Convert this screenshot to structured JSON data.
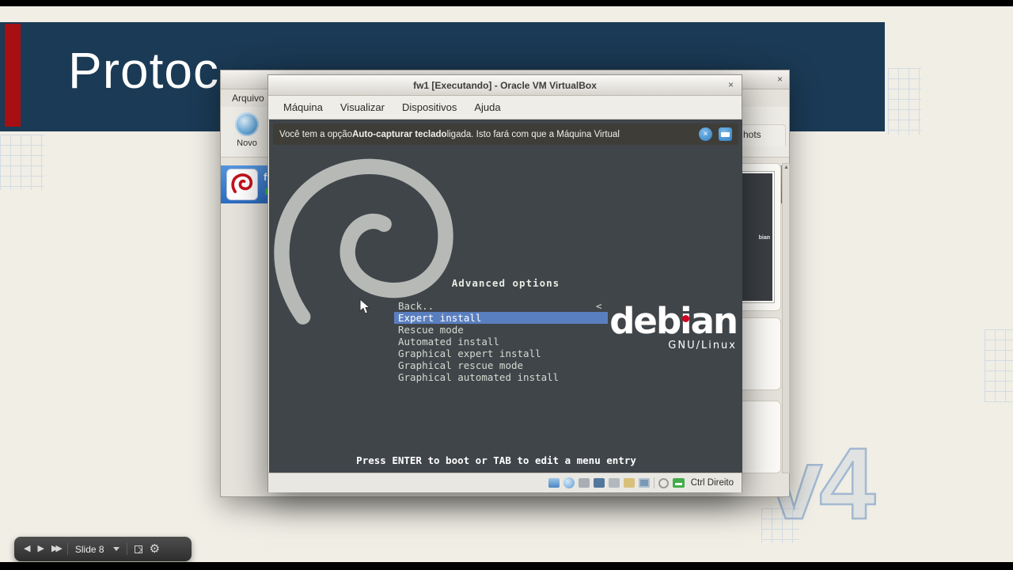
{
  "slide": {
    "title": "Protoc",
    "watermark": "v4"
  },
  "presenter_bar": {
    "slide_label": "Slide 8",
    "prev_glyph": "◀",
    "play_glyph": "▶",
    "next_glyph": "▶▶",
    "gear_glyph": "⚙"
  },
  "manager_window": {
    "menu_file": "Arquivo",
    "toolbar_new": "Novo",
    "vm_name": "fw",
    "snapshots_tab_fragment": "hots",
    "thumbnail_fragment": "bian",
    "close_glyph": "×",
    "scroll_up_glyph": "▲"
  },
  "vm_window": {
    "title": "fw1 [Executando] - Oracle VM VirtualBox",
    "close_glyph": "×",
    "menus": [
      "Máquina",
      "Visualizar",
      "Dispositivos",
      "Ajuda"
    ],
    "notification": {
      "prefix": "Você tem a opção ",
      "bold": "Auto-capturar teclado",
      "suffix": " ligada. Isto fará com que a Máquina Virtual",
      "close_glyph": "×"
    },
    "status": {
      "host_key": "Ctrl Direito",
      "icons": [
        "hard-disks",
        "optical-drives",
        "audio",
        "network",
        "usb",
        "shared-folders",
        "display",
        "mouse-integration",
        "keyboard"
      ]
    }
  },
  "boot_menu": {
    "heading": "Advanced options",
    "items": [
      "Back..",
      "Expert install",
      "Rescue mode",
      "Automated install",
      "Graphical expert install",
      "Graphical rescue mode",
      "Graphical automated install"
    ],
    "selected_index": 1,
    "back_arrow": "<",
    "footer": "Press ENTER to boot or TAB to edit a menu entry",
    "logo": {
      "name": "debian",
      "sub": "GNU/Linux"
    }
  }
}
